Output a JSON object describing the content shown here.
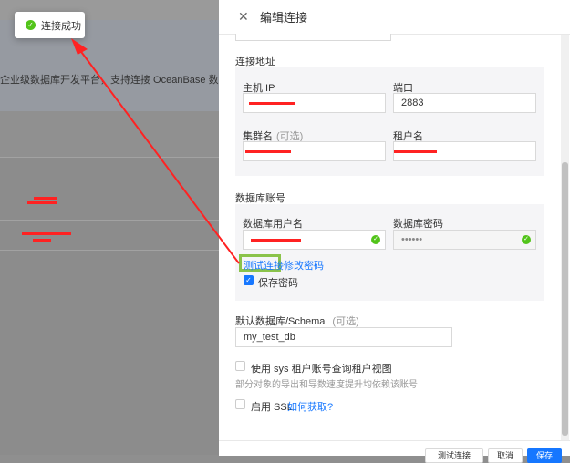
{
  "toast": {
    "text": "连接成功"
  },
  "background": {
    "description": "企业级数据库开发平台，支持连接 OceanBase 数据"
  },
  "drawer": {
    "title": "编辑连接",
    "address_section": "连接地址",
    "host_label": "主机 IP",
    "port_label": "端口",
    "port_value": "2883",
    "cluster_label": "集群名",
    "cluster_optional": "(可选)",
    "tenant_label": "租户名",
    "account_section": "数据库账号",
    "username_label": "数据库用户名",
    "password_label": "数据库密码",
    "password_value": "••••••",
    "test_connection": "测试连接",
    "change_password": "修改密码",
    "save_password": "保存密码",
    "default_db_label": "默认数据库/Schema",
    "default_db_optional": "(可选)",
    "default_db_value": "my_test_db",
    "sys_account_label": "使用 sys 租户账号查询租户视图",
    "sys_account_hint": "部分对象的导出和导数速度提升均依赖该账号",
    "ssl_label": "启用 SSL",
    "ssl_link": "如何获取?",
    "footer_btn1": "测试连接",
    "footer_btn2": "取消",
    "footer_btn3": "保存"
  },
  "colors": {
    "accent": "#1677ff",
    "success": "#52c41a",
    "annotation": "#ff2222",
    "highlight": "#8bc34a"
  }
}
